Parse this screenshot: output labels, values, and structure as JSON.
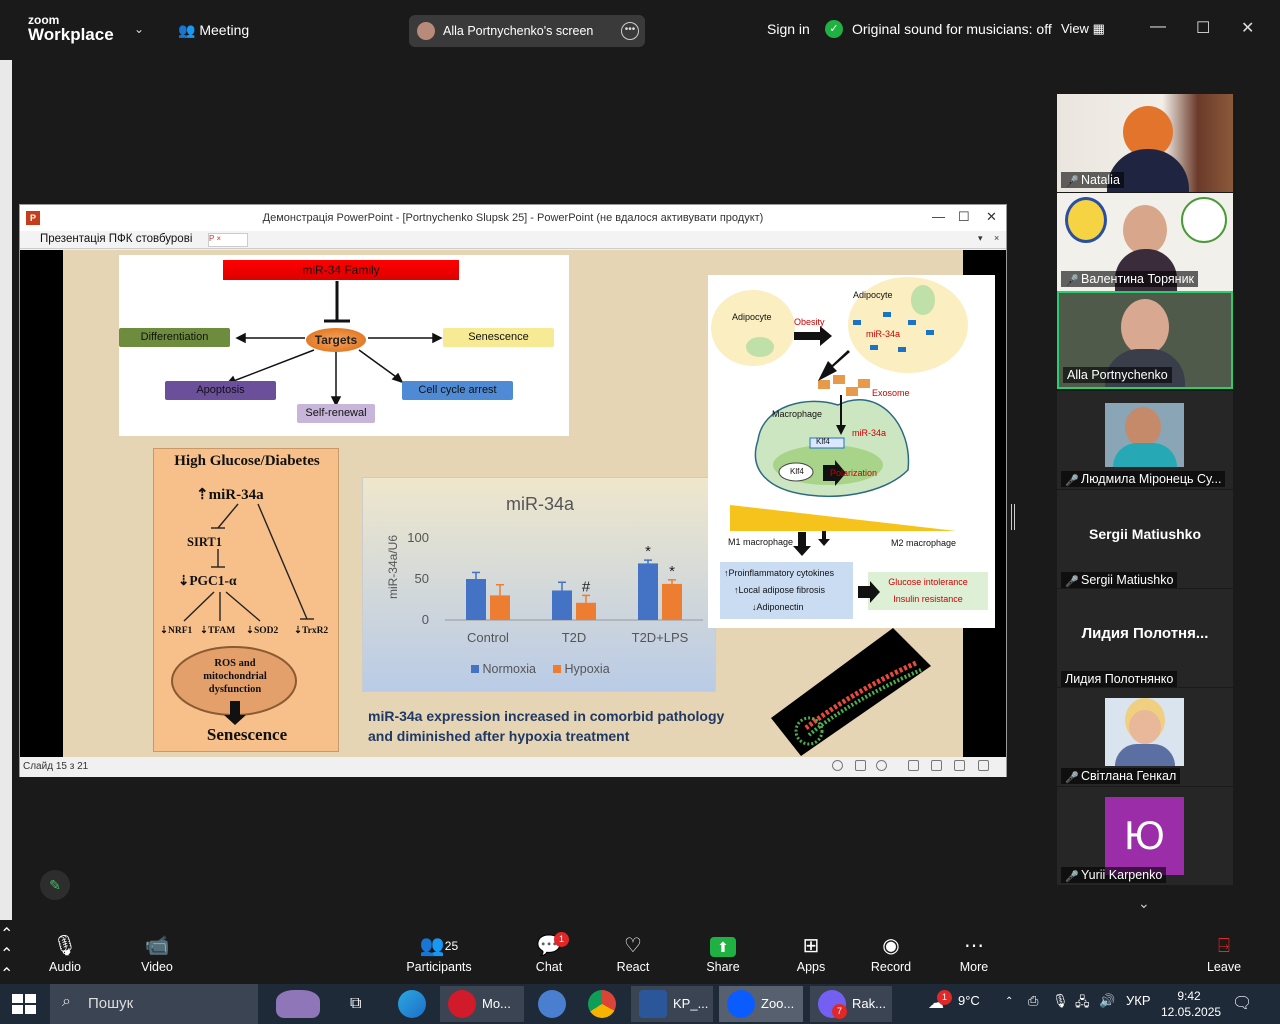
{
  "topbar": {
    "logo_small": "zoom",
    "logo_big": "Workplace",
    "meeting_label": "Meeting",
    "screen_share_label": "Alla Portnychenko's screen",
    "sign_in": "Sign in",
    "original_sound": "Original sound for musicians: off",
    "view_label": "View"
  },
  "ppt": {
    "window_title": "Демонстрація PowerPoint - [Portnychenko Slupsk 25] - PowerPoint (не вдалося активувати продукт)",
    "tab_label": "Презентація ПФК стовбурові",
    "status": "Слайд 15 з 21"
  },
  "slide": {
    "family_title": "miR-34 Family",
    "targets": "Targets",
    "differentiation": "Differentiation",
    "senescence_node": "Senescence",
    "apoptosis": "Apoptosis",
    "cell_cycle": "Cell cycle arrest",
    "self_renewal": "Self-renewal",
    "hg_title": "High Glucose/Diabetes",
    "hg_mir": "miR-34a",
    "hg_sirt": "SIRT1",
    "hg_pgc": "PGC1-α",
    "hg_nrf": "NRF1",
    "hg_tfam": "TFAM",
    "hg_sod": "SOD2",
    "hg_trx": "TrxR2",
    "hg_ros": "ROS and mitochondrial dysfunction",
    "hg_sen": "Senescence",
    "fig_adipocyte1": "Adipocyte",
    "fig_obesity": "Obesity",
    "fig_adipocyte2": "Adipocyte",
    "fig_mir": "miR-34a",
    "fig_exosome": "Exosome",
    "fig_macrophage": "Macrophage",
    "fig_klf4a": "Klf4",
    "fig_mir2": "miR-34a",
    "fig_klf4b": "Klf4",
    "fig_polarization": "Polarization",
    "fig_m1": "M1 macrophage",
    "fig_m2": "M2 macrophage",
    "fig_pro": "Proinflammatory cytokines",
    "fig_fib": "Local adipose fibrosis",
    "fig_adipo": "Adiponectin",
    "fig_gluc": "Glucose intolerance",
    "fig_ins": "Insulin resistance",
    "caption_line1": "miR-34a expression increased in comorbid pathology",
    "caption_line2": "and diminished after hypoxia treatment"
  },
  "chart_data": {
    "type": "bar",
    "title": "miR-34a",
    "ylabel": "miR-34a/U6",
    "xlabel": "",
    "ylim": [
      0,
      100
    ],
    "yticks": [
      0,
      50,
      100
    ],
    "categories": [
      "Control",
      "T2D",
      "T2D+LPS"
    ],
    "series": [
      {
        "name": "Normoxia",
        "color": "#4472c4",
        "values": [
          50,
          36,
          69
        ],
        "errors": [
          8,
          10,
          4
        ],
        "annotations": [
          "",
          "",
          "*"
        ]
      },
      {
        "name": "Hypoxia",
        "color": "#ed7d31",
        "values": [
          30,
          21,
          44
        ],
        "errors": [
          13,
          9,
          5
        ],
        "annotations": [
          "",
          "#",
          "*"
        ]
      }
    ],
    "legend_position": "bottom",
    "grid": false
  },
  "participants": [
    {
      "name": "Natalia",
      "muted": true
    },
    {
      "name": "Валентина Торяник",
      "muted": true
    },
    {
      "name": "Alla Portnychenko",
      "muted": false
    },
    {
      "name": "Людмила Міронець Су...",
      "muted": true
    },
    {
      "name": "Sergii Matiushko",
      "big": "Sergii Matiushko",
      "muted": true
    },
    {
      "name": "Лидия Полотнянко",
      "big": "Лидия Полотня...",
      "muted": false
    },
    {
      "name": "Світлана Генкал",
      "muted": true
    },
    {
      "name": "Yurii Karpenko",
      "avatar_letter": "Ю",
      "muted": true
    }
  ],
  "toolbar": {
    "audio": "Audio",
    "video": "Video",
    "participants": "Participants",
    "participants_count": "25",
    "chat": "Chat",
    "chat_badge": "1",
    "react": "React",
    "share": "Share",
    "apps": "Apps",
    "record": "Record",
    "more": "More",
    "leave": "Leave"
  },
  "taskbar": {
    "search": "Пошук",
    "app_opera": "Mo...",
    "app_word": "KP_...",
    "app_zoom": "Zoo...",
    "app_viber": "Rak...",
    "viber_badge": "7",
    "weather_badge": "1",
    "temp": "9°C",
    "lang": "УКР",
    "time": "9:42",
    "date": "12.05.2025"
  }
}
